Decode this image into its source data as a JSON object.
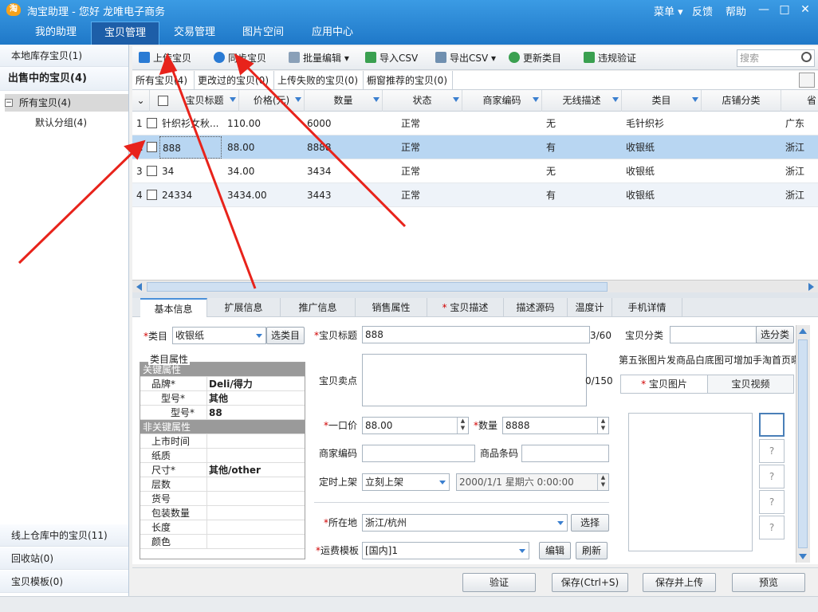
{
  "app": {
    "title": "淘宝助理 - 您好 龙唯电子商务",
    "logo": "淘"
  },
  "topmenu": {
    "menu": "菜单 ▾",
    "feedback": "反馈",
    "help": "帮助"
  },
  "maintabs": [
    "我的助理",
    "宝贝管理",
    "交易管理",
    "图片空间",
    "应用中心"
  ],
  "sidebar": {
    "local": "本地库存宝贝(1)",
    "onsale": "出售中的宝贝(4)",
    "all": "所有宝贝(4)",
    "default_group": "默认分组(4)",
    "warehouse": "线上仓库中的宝贝(11)",
    "recycle": "回收站(0)",
    "templates": "宝贝模板(0)"
  },
  "toolbar": {
    "upload": "上传宝贝",
    "sync": "同步宝贝",
    "batch_edit": "批量编辑",
    "import_csv": "导入CSV",
    "export_csv": "导出CSV",
    "update_category": "更新类目",
    "violation_check": "违规验证",
    "search_placeholder": "搜索"
  },
  "subtabs": [
    "所有宝贝(4)",
    "更改过的宝贝(0)",
    "上传失败的宝贝(0)",
    "橱窗推荐的宝贝(0)"
  ],
  "table": {
    "headers": [
      "宝贝标题",
      "价格(元)",
      "数量",
      "状态",
      "商家编码",
      "无线描述",
      "类目",
      "店铺分类",
      "省"
    ],
    "rows": [
      {
        "no": "1",
        "title": "针织衫女秋...",
        "price": "110.00",
        "qty": "6000",
        "status": "正常",
        "code": "",
        "wireless": "无",
        "category": "毛针织衫",
        "shopcat": "",
        "prov": "广东"
      },
      {
        "no": "2",
        "title": "888",
        "price": "88.00",
        "qty": "8888",
        "status": "正常",
        "code": "",
        "wireless": "有",
        "category": "收银纸",
        "shopcat": "",
        "prov": "浙江"
      },
      {
        "no": "3",
        "title": "34",
        "price": "34.00",
        "qty": "3434",
        "status": "正常",
        "code": "",
        "wireless": "无",
        "category": "收银纸",
        "shopcat": "",
        "prov": "浙江"
      },
      {
        "no": "4",
        "title": "24334",
        "price": "3434.00",
        "qty": "3443",
        "status": "正常",
        "code": "",
        "wireless": "有",
        "category": "收银纸",
        "shopcat": "",
        "prov": "浙江"
      }
    ]
  },
  "detail_tabs": [
    "基本信息",
    "扩展信息",
    "推广信息",
    "销售属性",
    "宝贝描述",
    "描述源码",
    "温度计",
    "手机详情"
  ],
  "form": {
    "category_label": "类目",
    "category_value": "收银纸",
    "choose_category": "选类目",
    "attr_group": "类目属性",
    "key_attrs": "关键属性",
    "brand_label": "品牌*",
    "brand_value": "Deli/得力",
    "model_label": "型号*",
    "model_value": "其他",
    "model2_label": "型号*",
    "model2_value": "88",
    "nonkey_attrs": "非关键属性",
    "attr_launch": "上市时间",
    "attr_paper": "纸质",
    "attr_size": "尺寸*",
    "attr_size_value": "其他/other",
    "attr_layers": "层数",
    "attr_itemno": "货号",
    "attr_pack": "包装数量",
    "attr_length": "长度",
    "attr_color": "颜色",
    "title_label": "宝贝标题",
    "title_value": "888",
    "title_count": "3/60",
    "selling_label": "宝贝卖点",
    "selling_count": "0/150",
    "price_label": "一口价",
    "price_value": "88.00",
    "qty_label": "数量",
    "qty_value": "8888",
    "code_label": "商家编码",
    "barcode_label": "商品条码",
    "schedule_label": "定时上架",
    "schedule_value": "立刻上架",
    "schedule_time": "2000/1/1 星期六 0:00:00",
    "location_label": "所在地",
    "location_value": "浙江/杭州",
    "choose": "选择",
    "shipping_label": "运费模板",
    "shipping_value": "[国内]1",
    "edit": "编辑",
    "refresh": "刷新",
    "shopcat_label": "宝贝分类",
    "choose_shopcat": "选分类",
    "tip": "第五张图片发商品白底图可增加手淘首页曝",
    "pic_tab": "宝贝图片",
    "video_tab": "宝贝视频",
    "q": "?"
  },
  "actions": {
    "verify": "验证",
    "save": "保存(Ctrl+S)",
    "save_upload": "保存并上传",
    "preview": "预览"
  }
}
